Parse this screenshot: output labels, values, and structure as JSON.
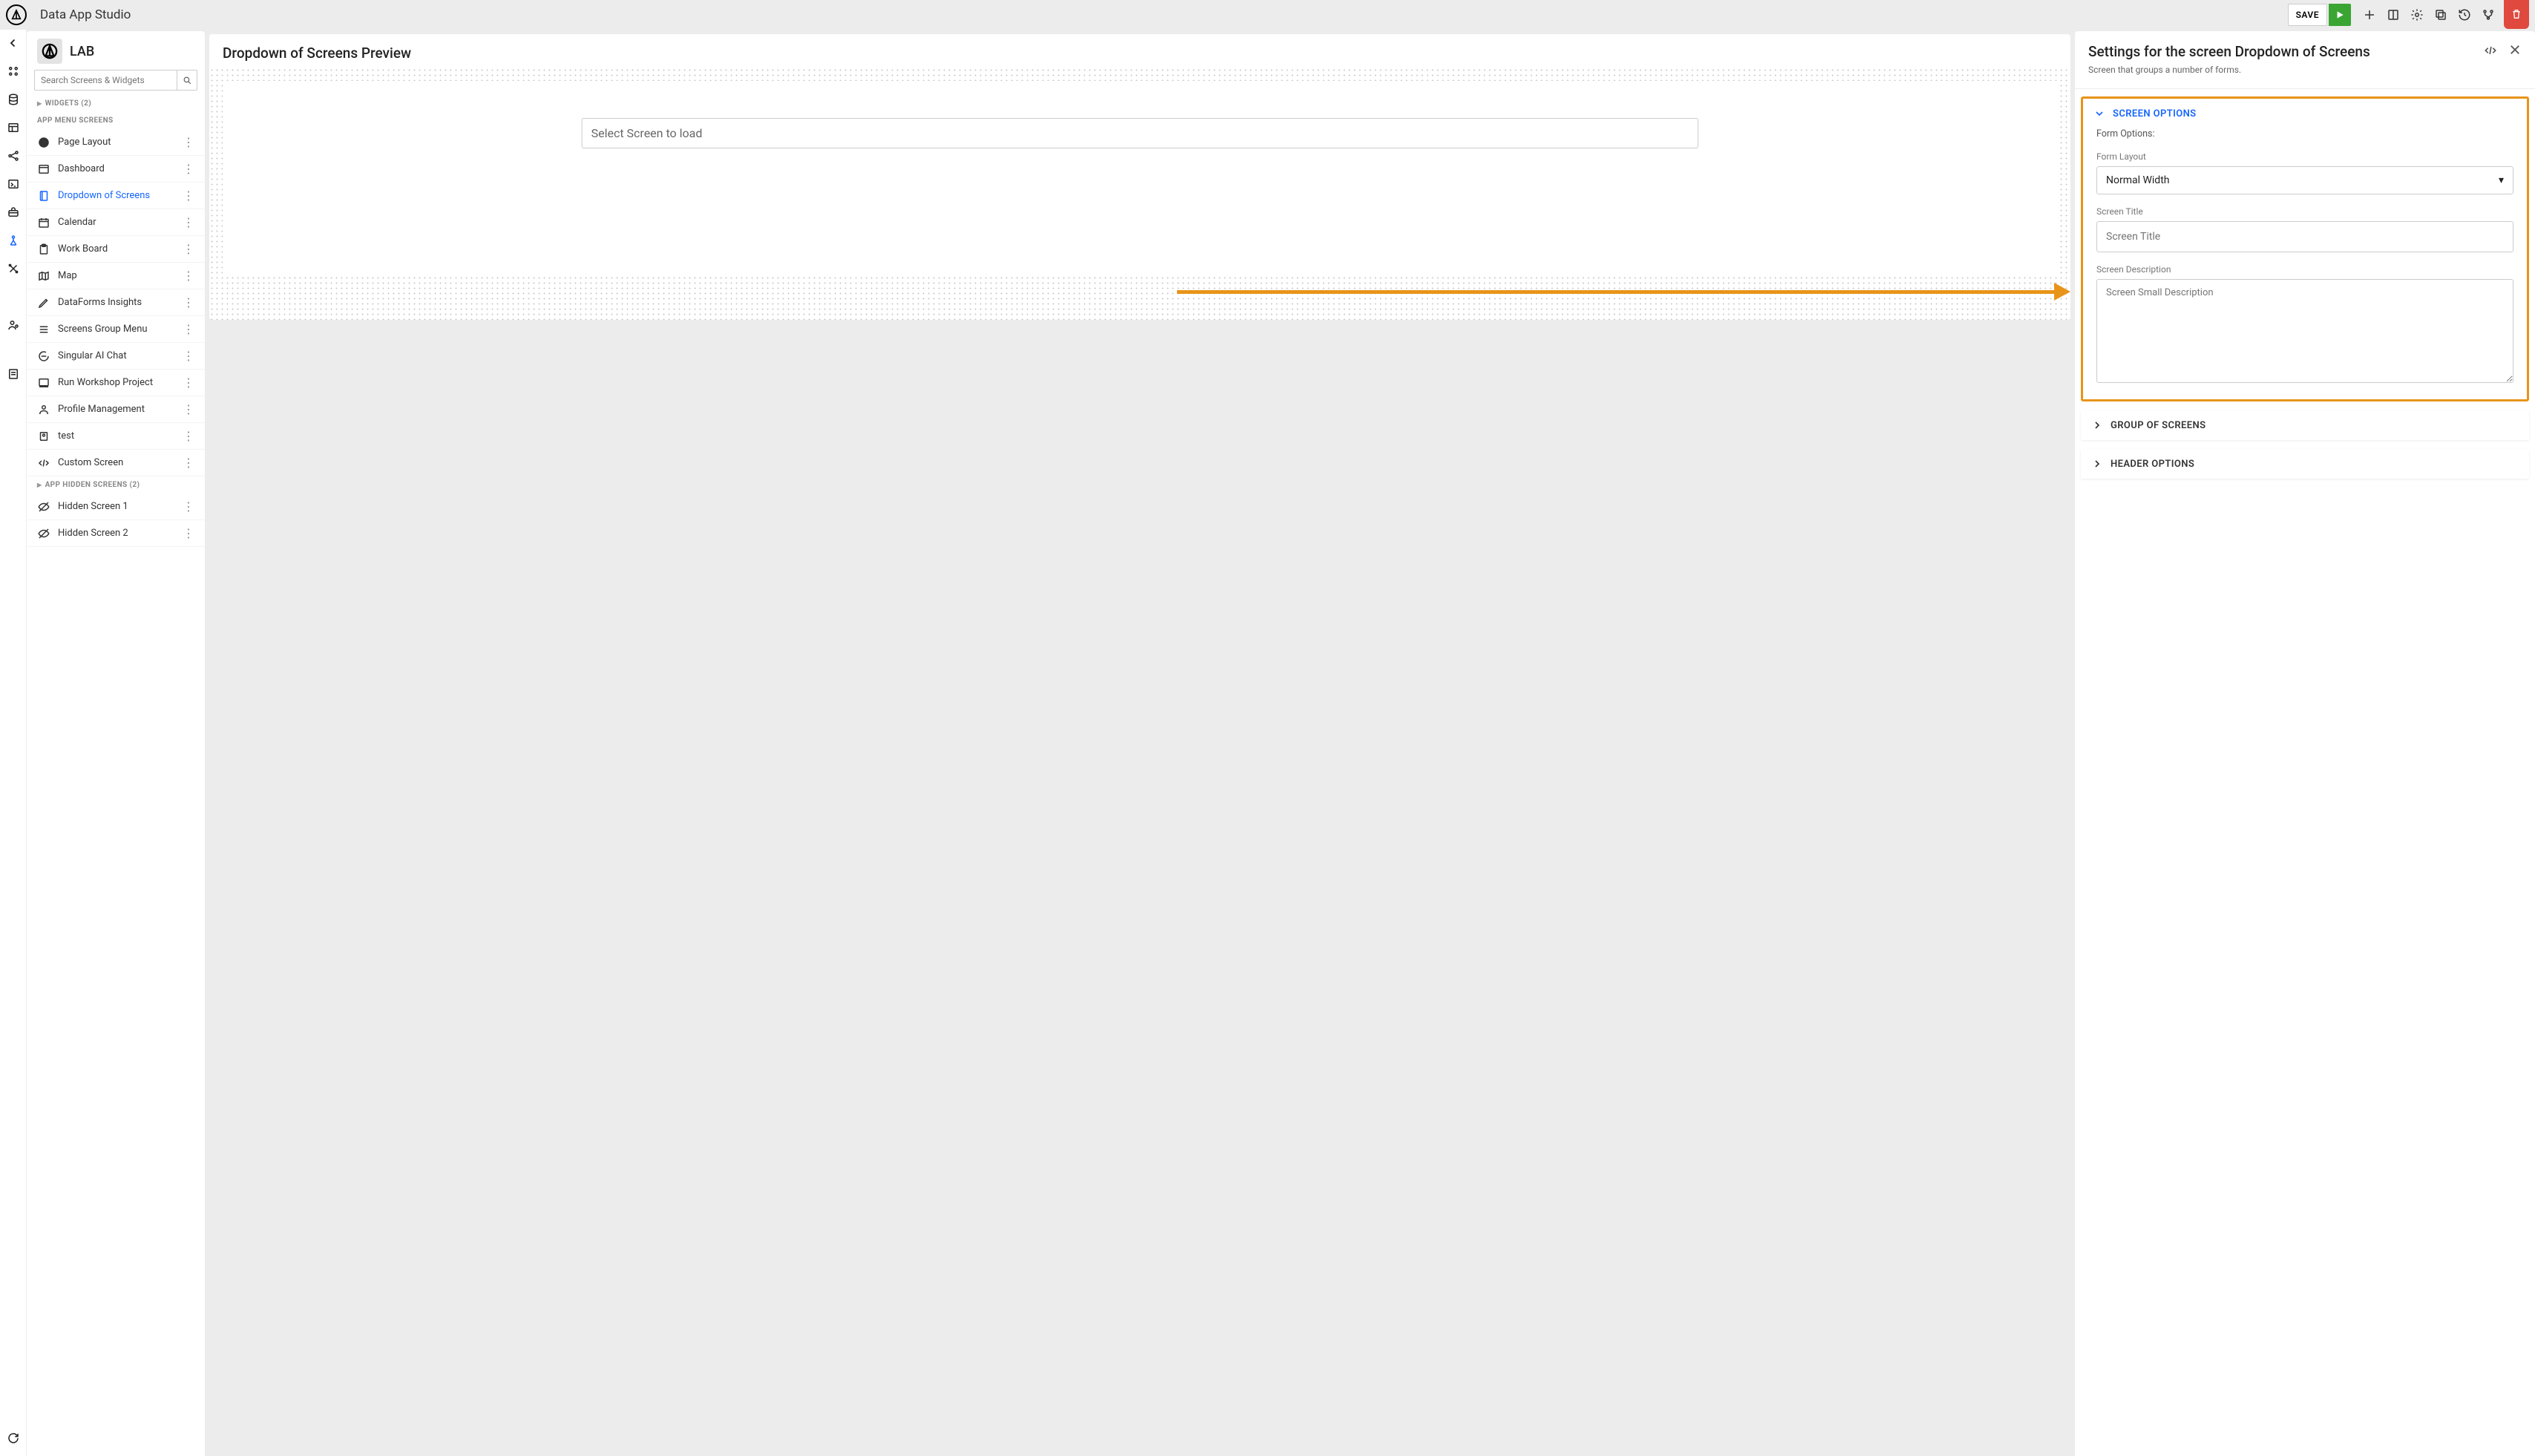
{
  "topbar": {
    "app_title": "Data App Studio",
    "save_label": "SAVE"
  },
  "sidebar": {
    "app_name": "LAB",
    "search_placeholder": "Search Screens & Widgets",
    "section_widgets": "WIDGETS (2)",
    "section_menu": "APP MENU SCREENS",
    "section_hidden": "APP HIDDEN SCREENS (2)",
    "items": [
      {
        "label": "Page Layout"
      },
      {
        "label": "Dashboard"
      },
      {
        "label": "Dropdown of Screens"
      },
      {
        "label": "Calendar"
      },
      {
        "label": "Work Board"
      },
      {
        "label": "Map"
      },
      {
        "label": "DataForms Insights"
      },
      {
        "label": "Screens Group Menu"
      },
      {
        "label": "Singular AI Chat"
      },
      {
        "label": "Run Workshop Project"
      },
      {
        "label": "Profile Management"
      },
      {
        "label": "test"
      },
      {
        "label": "Custom Screen"
      }
    ],
    "hidden_items": [
      {
        "label": "Hidden Screen 1"
      },
      {
        "label": "Hidden Screen 2"
      }
    ]
  },
  "preview": {
    "title": "Dropdown of Screens Preview",
    "select_placeholder": "Select Screen to load"
  },
  "settings": {
    "title": "Settings for the screen Dropdown of Screens",
    "subtitle": "Screen that groups a number of forms.",
    "panels": {
      "screen_options": "SCREEN OPTIONS",
      "group_of_screens": "GROUP OF SCREENS",
      "header_options": "HEADER OPTIONS"
    },
    "form": {
      "form_options_label": "Form Options:",
      "form_layout_label": "Form Layout",
      "form_layout_value": "Normal Width",
      "screen_title_label": "Screen Title",
      "screen_title_placeholder": "Screen Title",
      "screen_desc_label": "Screen Description",
      "screen_desc_placeholder": "Screen Small Description"
    }
  }
}
